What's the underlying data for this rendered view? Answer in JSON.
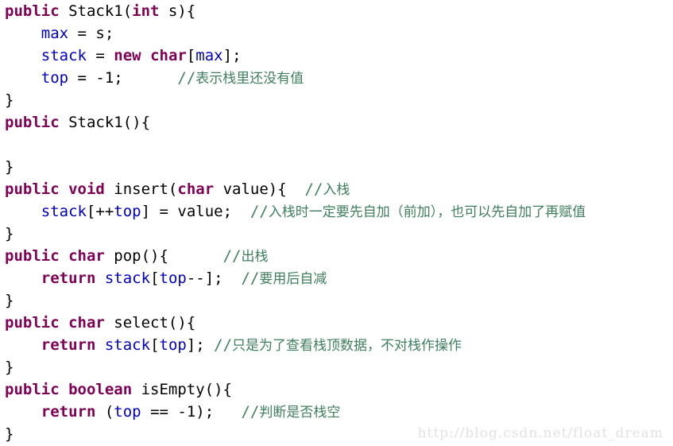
{
  "document": {
    "kind": "source-code-screenshot",
    "language": "Java",
    "class_name": "Stack1",
    "background_color": "#ffffff",
    "colors": {
      "keyword": "#7f0055",
      "field_variable": "#0000c0",
      "comment": "#3f7f5f",
      "plain_text": "#000000",
      "watermark": "#e2e2e2"
    }
  },
  "watermark": {
    "text": "http://blog.csdn.net/float_dream"
  },
  "code": {
    "lines": [
      {
        "id": "line-1",
        "plain": "public Stack1(int s){",
        "tokens": [
          {
            "t": "public",
            "k": "keyword"
          },
          {
            "t": " Stack1(",
            "k": "plain"
          },
          {
            "t": "int",
            "k": "keyword"
          },
          {
            "t": " s){",
            "k": "plain"
          }
        ]
      },
      {
        "id": "line-2",
        "plain": "    max = s;",
        "tokens": [
          {
            "t": "    ",
            "k": "plain"
          },
          {
            "t": "max",
            "k": "field"
          },
          {
            "t": " = s;",
            "k": "plain"
          }
        ]
      },
      {
        "id": "line-3",
        "plain": "    stack = new char[max];",
        "tokens": [
          {
            "t": "    ",
            "k": "plain"
          },
          {
            "t": "stack",
            "k": "field"
          },
          {
            "t": " = ",
            "k": "plain"
          },
          {
            "t": "new",
            "k": "keyword"
          },
          {
            "t": " ",
            "k": "plain"
          },
          {
            "t": "char",
            "k": "keyword"
          },
          {
            "t": "[",
            "k": "plain"
          },
          {
            "t": "max",
            "k": "field"
          },
          {
            "t": "];",
            "k": "plain"
          }
        ]
      },
      {
        "id": "line-4",
        "plain": "    top = -1;      //表示栈里还没有值",
        "tokens": [
          {
            "t": "    ",
            "k": "plain"
          },
          {
            "t": "top",
            "k": "field"
          },
          {
            "t": " = -1;      ",
            "k": "plain"
          },
          {
            "t": "//",
            "k": "comment"
          },
          {
            "t": "表示栈里还没有值",
            "k": "comment-cjk"
          }
        ]
      },
      {
        "id": "line-5",
        "plain": "}",
        "tokens": [
          {
            "t": "}",
            "k": "plain"
          }
        ]
      },
      {
        "id": "line-6",
        "plain": "public Stack1(){",
        "tokens": [
          {
            "t": "public",
            "k": "keyword"
          },
          {
            "t": " Stack1(){",
            "k": "plain"
          }
        ]
      },
      {
        "id": "line-7",
        "plain": "",
        "tokens": []
      },
      {
        "id": "line-8",
        "plain": "}",
        "tokens": [
          {
            "t": "}",
            "k": "plain"
          }
        ]
      },
      {
        "id": "line-9",
        "plain": "public void insert(char value){  //入栈",
        "tokens": [
          {
            "t": "public",
            "k": "keyword"
          },
          {
            "t": " ",
            "k": "plain"
          },
          {
            "t": "void",
            "k": "keyword"
          },
          {
            "t": " insert(",
            "k": "plain"
          },
          {
            "t": "char",
            "k": "keyword"
          },
          {
            "t": " value){  ",
            "k": "plain"
          },
          {
            "t": "//",
            "k": "comment"
          },
          {
            "t": "入栈",
            "k": "comment-cjk"
          }
        ]
      },
      {
        "id": "line-10",
        "plain": "    stack[++top] = value;  //入栈时一定要先自加（前加），也可以先自加了再赋值",
        "tokens": [
          {
            "t": "    ",
            "k": "plain"
          },
          {
            "t": "stack",
            "k": "field"
          },
          {
            "t": "[++",
            "k": "plain"
          },
          {
            "t": "top",
            "k": "field"
          },
          {
            "t": "] = value;  ",
            "k": "plain"
          },
          {
            "t": "//",
            "k": "comment"
          },
          {
            "t": "入栈时一定要先自加（前加），也可以先自加了再赋值",
            "k": "comment-cjk"
          }
        ]
      },
      {
        "id": "line-11",
        "plain": "}",
        "tokens": [
          {
            "t": "}",
            "k": "plain"
          }
        ]
      },
      {
        "id": "line-12",
        "plain": "public char pop(){      //出栈",
        "tokens": [
          {
            "t": "public",
            "k": "keyword"
          },
          {
            "t": " ",
            "k": "plain"
          },
          {
            "t": "char",
            "k": "keyword"
          },
          {
            "t": " pop(){      ",
            "k": "plain"
          },
          {
            "t": "//",
            "k": "comment"
          },
          {
            "t": "出栈",
            "k": "comment-cjk"
          }
        ]
      },
      {
        "id": "line-13",
        "plain": "    return stack[top--];  //要用后自减",
        "tokens": [
          {
            "t": "    ",
            "k": "plain"
          },
          {
            "t": "return",
            "k": "keyword"
          },
          {
            "t": " ",
            "k": "plain"
          },
          {
            "t": "stack",
            "k": "field"
          },
          {
            "t": "[",
            "k": "plain"
          },
          {
            "t": "top",
            "k": "field"
          },
          {
            "t": "--];  ",
            "k": "plain"
          },
          {
            "t": "//",
            "k": "comment"
          },
          {
            "t": "要用后自减",
            "k": "comment-cjk"
          }
        ]
      },
      {
        "id": "line-14",
        "plain": "}",
        "tokens": [
          {
            "t": "}",
            "k": "plain"
          }
        ]
      },
      {
        "id": "line-15",
        "plain": "public char select(){",
        "tokens": [
          {
            "t": "public",
            "k": "keyword"
          },
          {
            "t": " ",
            "k": "plain"
          },
          {
            "t": "char",
            "k": "keyword"
          },
          {
            "t": " select(){",
            "k": "plain"
          }
        ]
      },
      {
        "id": "line-16",
        "plain": "    return stack[top]; //只是为了查看栈顶数据，不对栈作操作",
        "tokens": [
          {
            "t": "    ",
            "k": "plain"
          },
          {
            "t": "return",
            "k": "keyword"
          },
          {
            "t": " ",
            "k": "plain"
          },
          {
            "t": "stack",
            "k": "field"
          },
          {
            "t": "[",
            "k": "plain"
          },
          {
            "t": "top",
            "k": "field"
          },
          {
            "t": "]; ",
            "k": "plain"
          },
          {
            "t": "//",
            "k": "comment"
          },
          {
            "t": "只是为了查看栈顶数据，不对栈作操作",
            "k": "comment-cjk"
          }
        ]
      },
      {
        "id": "line-17",
        "plain": "}",
        "tokens": [
          {
            "t": "}",
            "k": "plain"
          }
        ]
      },
      {
        "id": "line-18",
        "plain": "public boolean isEmpty(){",
        "tokens": [
          {
            "t": "public",
            "k": "keyword"
          },
          {
            "t": " ",
            "k": "plain"
          },
          {
            "t": "boolean",
            "k": "keyword"
          },
          {
            "t": " isEmpty(){",
            "k": "plain"
          }
        ]
      },
      {
        "id": "line-19",
        "plain": "    return (top == -1);   //判断是否栈空",
        "tokens": [
          {
            "t": "    ",
            "k": "plain"
          },
          {
            "t": "return",
            "k": "keyword"
          },
          {
            "t": " (",
            "k": "plain"
          },
          {
            "t": "top",
            "k": "field"
          },
          {
            "t": " == -1);   ",
            "k": "plain"
          },
          {
            "t": "//",
            "k": "comment"
          },
          {
            "t": "判断是否栈空",
            "k": "comment-cjk"
          }
        ]
      },
      {
        "id": "line-20",
        "plain": "}",
        "tokens": [
          {
            "t": "}",
            "k": "plain"
          }
        ]
      }
    ]
  }
}
